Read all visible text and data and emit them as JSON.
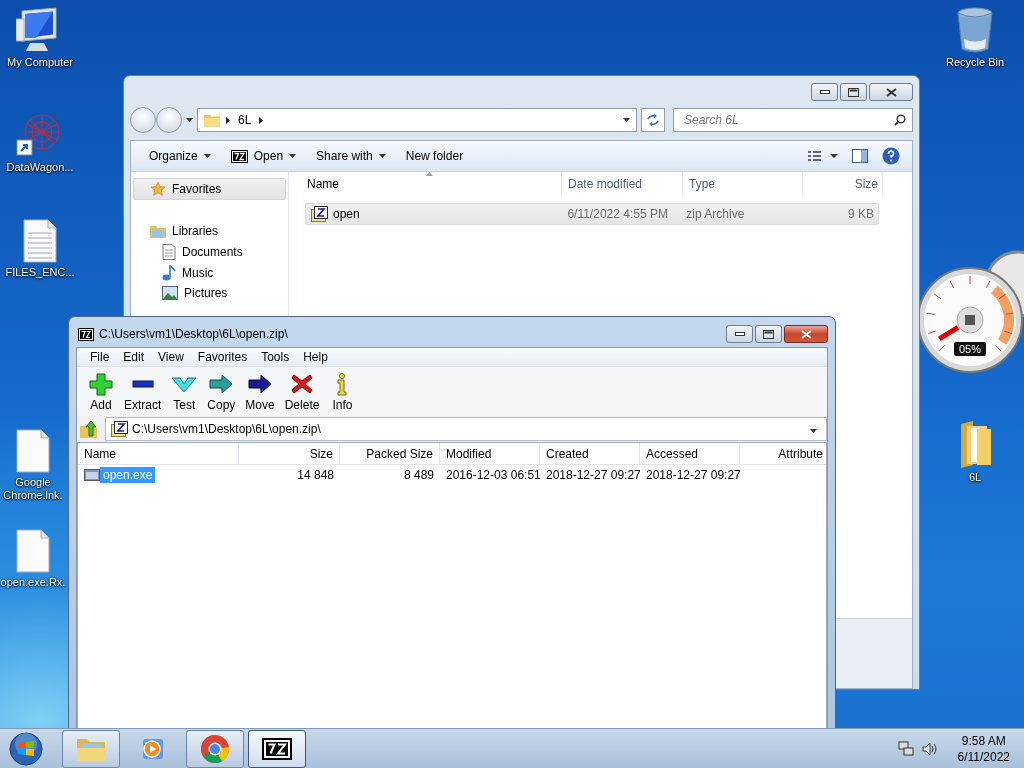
{
  "desktop": {
    "icons": [
      {
        "label": "My Computer",
        "kind": "computer"
      },
      {
        "label": "DataWagon...",
        "kind": "shortcut"
      },
      {
        "label": "FILES_ENC...",
        "kind": "text"
      },
      {
        "label": "Google Chrome.lnk.",
        "kind": "blank"
      },
      {
        "label": "open.exe.Rx.",
        "kind": "blank"
      },
      {
        "label": "Recycle Bin",
        "kind": "recycle"
      },
      {
        "label": "6L",
        "kind": "folder"
      }
    ]
  },
  "explorer": {
    "active": false,
    "breadcrumb": [
      "6L"
    ],
    "search": {
      "placeholder": "Search 6L"
    },
    "toolbar": [
      {
        "label": "Organize",
        "kind": "plain",
        "dropdown": true
      },
      {
        "label": "Open",
        "kind": "sevenzip",
        "dropdown": true
      },
      {
        "label": "Share with",
        "kind": "plain",
        "dropdown": true
      },
      {
        "label": "New folder",
        "kind": "plain",
        "dropdown": false
      }
    ],
    "sidebar": [
      {
        "label": "Favorites",
        "kind": "star",
        "selected": true
      },
      {
        "label": "Libraries",
        "kind": "library",
        "selected": false,
        "children": [
          {
            "label": "Documents",
            "kind": "document",
            "selected": false
          },
          {
            "label": "Music",
            "kind": "music",
            "selected": false
          },
          {
            "label": "Pictures",
            "kind": "picture",
            "selected": false
          }
        ]
      }
    ],
    "columns": [
      "Name",
      "Date modified",
      "Type",
      "Size"
    ],
    "rows": [
      {
        "name": "open",
        "date": "6/11/2022 4:55 PM",
        "type": "zip Archive",
        "size": "9 KB",
        "selected": true
      }
    ]
  },
  "sevenzip": {
    "active": true,
    "title": "C:\\Users\\vm1\\Desktop\\6L\\open.zip\\",
    "menu": [
      "File",
      "Edit",
      "View",
      "Favorites",
      "Tools",
      "Help"
    ],
    "tools": [
      {
        "label": "Add",
        "kind": "add"
      },
      {
        "label": "Extract",
        "kind": "extract"
      },
      {
        "label": "Test",
        "kind": "test"
      },
      {
        "label": "Copy",
        "kind": "copy"
      },
      {
        "label": "Move",
        "kind": "move"
      },
      {
        "label": "Delete",
        "kind": "delete"
      },
      {
        "label": "Info",
        "kind": "info"
      }
    ],
    "path": "C:\\Users\\vm1\\Desktop\\6L\\open.zip\\",
    "columns": [
      "Name",
      "Size",
      "Packed Size",
      "Modified",
      "Created",
      "Accessed",
      "Attribute"
    ],
    "rows": [
      {
        "cells": [
          "open.exe",
          "14 848",
          "8 489",
          "2016-12-03 06:51",
          "2018-12-27 09:27",
          "2018-12-27 09:27"
        ],
        "selected": true
      }
    ]
  },
  "gadget": {
    "reading": "05%"
  },
  "taskbar": {
    "buttons": [
      {
        "kind": "explorer",
        "running": true,
        "active": false
      },
      {
        "kind": "media",
        "running": false,
        "active": false
      },
      {
        "kind": "chrome",
        "running": true,
        "active": false
      },
      {
        "kind": "sevenzip",
        "running": true,
        "active": true
      }
    ],
    "time": "9:58 AM",
    "date": "6/11/2022"
  }
}
